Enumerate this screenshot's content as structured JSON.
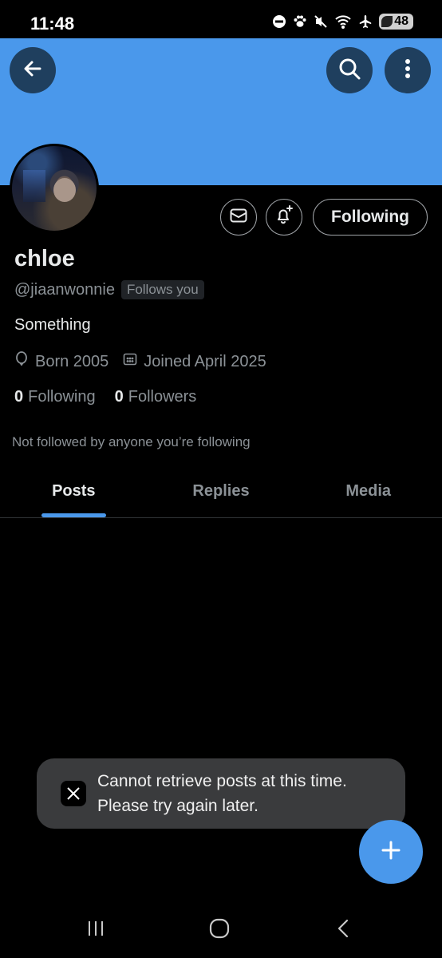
{
  "status_bar": {
    "time": "11:48",
    "battery": "48",
    "icons": [
      "dnd-icon",
      "paw-icon",
      "mute-icon",
      "wifi-icon",
      "airplane-icon",
      "battery-icon"
    ]
  },
  "header": {
    "banner_color": "#4a98eb",
    "back_icon": "arrow-left-icon",
    "search_icon": "search-icon",
    "more_icon": "more-vertical-icon"
  },
  "profile": {
    "display_name": "chloe",
    "handle": "@jiaanwonnie",
    "follows_you_badge": "Follows you",
    "bio": "Something",
    "born": "Born 2005",
    "joined": "Joined April 2025",
    "following_count": "0",
    "following_label": "Following",
    "followers_count": "0",
    "followers_label": "Followers",
    "not_followed_text": "Not followed by anyone you’re following"
  },
  "actions": {
    "message_icon": "mail-icon",
    "notify_icon": "bell-plus-icon",
    "following_button": "Following"
  },
  "tabs": [
    {
      "label": "Posts",
      "active": true
    },
    {
      "label": "Replies",
      "active": false
    },
    {
      "label": "Media",
      "active": false
    }
  ],
  "toast": {
    "logo": "x-logo",
    "message": "Cannot retrieve posts at this time. Please try again later."
  },
  "fab": {
    "icon": "plus-icon"
  },
  "nav_bar": {
    "icons": [
      "recents-icon",
      "home-icon",
      "back-icon"
    ]
  },
  "colors": {
    "accent": "#4a98eb",
    "background": "#000000",
    "muted_text": "#8b9196"
  }
}
